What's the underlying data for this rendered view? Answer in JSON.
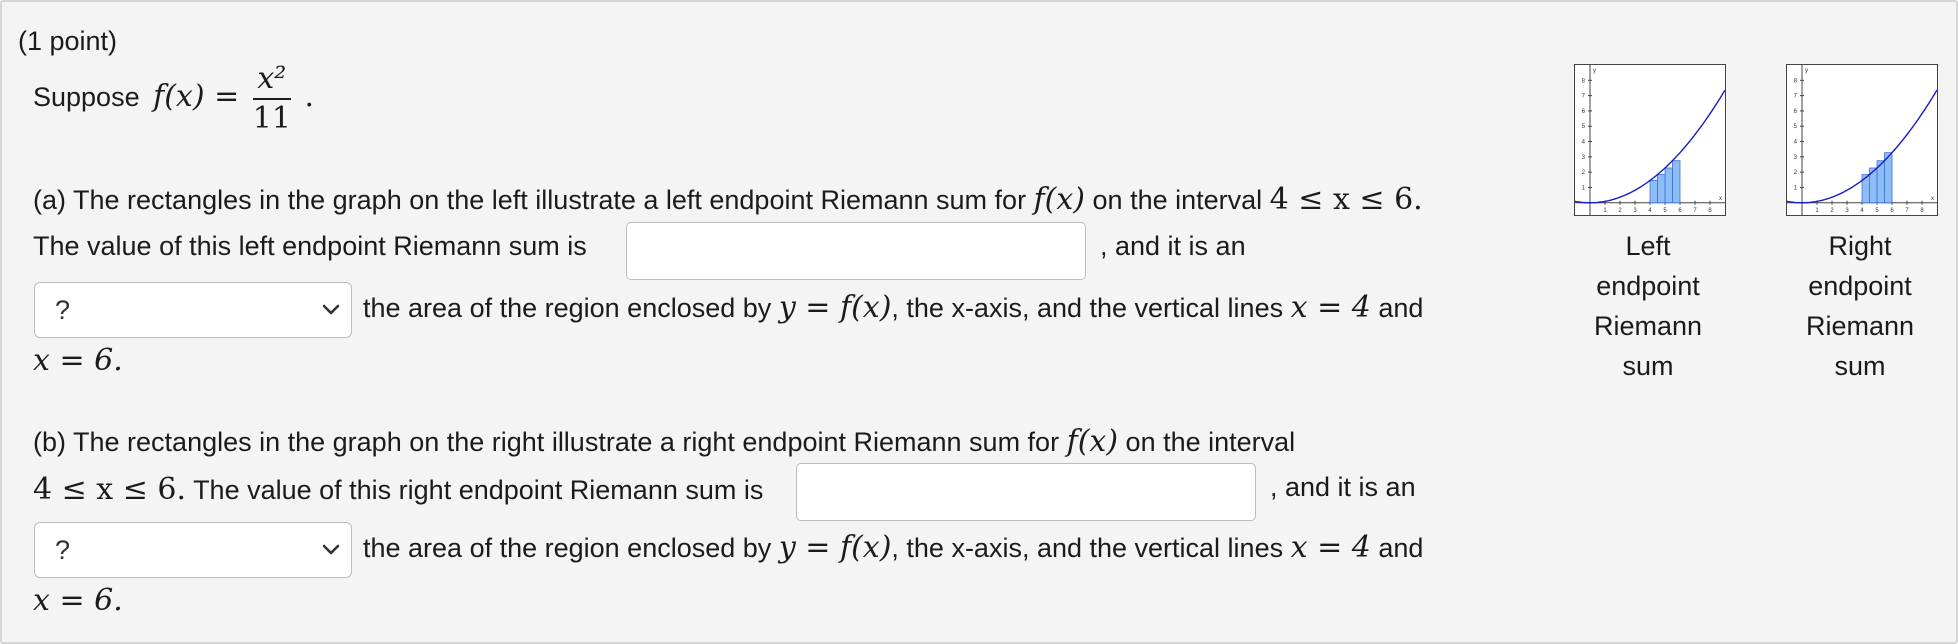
{
  "header": {
    "points": "(1 point)"
  },
  "intro": {
    "prefix": "Suppose",
    "func": "f(x) =",
    "numerator": "x²",
    "denominator": "11",
    "suffix": "."
  },
  "part_a": {
    "line1_text": "(a) The rectangles in the graph on the left illustrate a left endpoint Riemann sum for",
    "line1_func": "f(x)",
    "line1_mid": "on the interval",
    "line1_interval": "4 ≤ x ≤ 6.",
    "line2_text": "The value of this left endpoint Riemann sum is",
    "line2_after": ", and it is an",
    "answer_value": "",
    "select_value": "?",
    "line3_text": "the area of the region enclosed by",
    "line3_eq": "y = f(x)",
    "line3_mid": ", the x-axis, and the vertical lines",
    "line3_x4": "x = 4",
    "line3_and": "and",
    "line4_x6": "x = 6."
  },
  "part_b": {
    "line1_text": "(b) The rectangles in the graph on the right illustrate a right endpoint Riemann sum for",
    "line1_func": "f(x)",
    "line1_mid": "on the interval",
    "line2_interval": "4 ≤ x ≤ 6.",
    "line2_text": "The value of this right endpoint Riemann sum is",
    "line2_after": ", and it is an",
    "answer_value": "",
    "select_value": "?",
    "line3_text": "the area of the region enclosed by",
    "line3_eq": "y = f(x)",
    "line3_mid": ", the x-axis, and the vertical lines",
    "line3_x4": "x = 4",
    "line3_and": "and",
    "line4_x6": "x = 6."
  },
  "graphs": {
    "left_caption": "Left\nendpoint\nRiemann\nsum",
    "right_caption": "Right\nendpoint\nRiemann\nsum",
    "x_ticks": [
      "1",
      "2",
      "3",
      "4",
      "5",
      "6",
      "7",
      "8"
    ],
    "y_ticks": [
      "1",
      "2",
      "3",
      "4",
      "5",
      "6",
      "7",
      "8"
    ],
    "x_axis_letter": "x",
    "y_axis_letter": "y",
    "curve_color": "#1a1acc",
    "bar_fill": "#8ebcf5",
    "bar_stroke": "#3a74d6",
    "left_bars": [
      {
        "x": 4.0,
        "h": 1.4545
      },
      {
        "x": 4.5,
        "h": 1.8409
      },
      {
        "x": 5.0,
        "h": 2.2727
      },
      {
        "x": 5.5,
        "h": 2.75
      }
    ],
    "right_bars": [
      {
        "x": 4.0,
        "h": 1.8409
      },
      {
        "x": 4.5,
        "h": 2.2727
      },
      {
        "x": 5.0,
        "h": 2.75
      },
      {
        "x": 5.5,
        "h": 3.2727
      }
    ]
  }
}
